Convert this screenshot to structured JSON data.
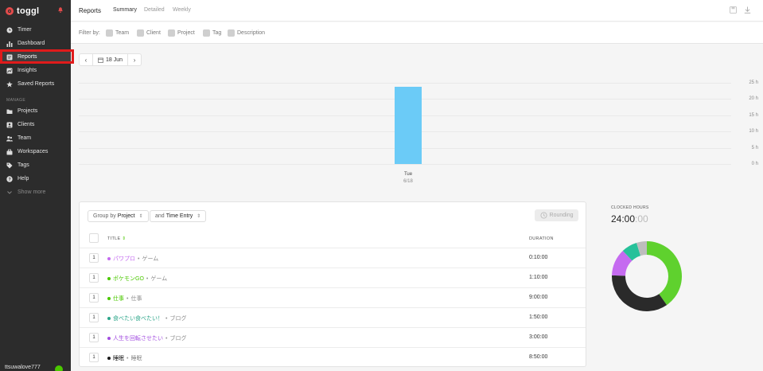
{
  "sidebar": {
    "brand": "toggl",
    "items": [
      {
        "label": "Timer",
        "icon": "clock-icon"
      },
      {
        "label": "Dashboard",
        "icon": "bar-chart-icon"
      },
      {
        "label": "Reports",
        "icon": "report-icon"
      },
      {
        "label": "Insights",
        "icon": "insights-icon"
      },
      {
        "label": "Saved Reports",
        "icon": "star-icon"
      }
    ],
    "manage_label": "MANAGE",
    "manage_items": [
      {
        "label": "Projects",
        "icon": "folder-icon"
      },
      {
        "label": "Clients",
        "icon": "clients-icon"
      },
      {
        "label": "Team",
        "icon": "team-icon"
      },
      {
        "label": "Workspaces",
        "icon": "workspaces-icon"
      },
      {
        "label": "Tags",
        "icon": "tag-icon"
      },
      {
        "label": "Help",
        "icon": "help-icon"
      },
      {
        "label": "Show more",
        "icon": "chevron-down-icon"
      }
    ],
    "user": "ttsuwalove777"
  },
  "header": {
    "title": "Reports",
    "tabs": [
      "Summary",
      "Detailed",
      "Weekly"
    ]
  },
  "filters": {
    "label": "Filter by:",
    "items": [
      "Team",
      "Client",
      "Project",
      "Tag",
      "Description"
    ]
  },
  "date_nav": {
    "date": "18 Jun",
    "prev": "‹",
    "next": "›"
  },
  "chart_data": {
    "type": "bar",
    "categories": [
      "Tue"
    ],
    "sublabels": [
      "6/18"
    ],
    "values": [
      23.8
    ],
    "yticks": [
      "25 h",
      "20 h",
      "15 h",
      "10 h",
      "5 h",
      "0 h"
    ],
    "ylim": [
      0,
      25
    ],
    "color": "#6bcbf7"
  },
  "table": {
    "group_by_prefix": "Group by",
    "group_by_value": "Project",
    "and_prefix": "and",
    "and_value": "Time Entry",
    "rounding": "Rounding",
    "col_title": "TITLE",
    "col_duration": "DURATION",
    "rows": [
      {
        "count": "1",
        "project": "パワプロ",
        "client": "ゲーム",
        "duration": "0:10:00",
        "color": "#c56bf0"
      },
      {
        "count": "1",
        "project": "ポケモンGO",
        "client": "ゲーム",
        "duration": "1:10:00",
        "color": "#4bc800"
      },
      {
        "count": "1",
        "project": "仕事",
        "client": "仕事",
        "duration": "9:00:00",
        "color": "#4bc800"
      },
      {
        "count": "1",
        "project": "食べたい食べたい！",
        "client": "ブログ",
        "duration": "1:50:00",
        "color": "#2da68a"
      },
      {
        "count": "1",
        "project": "人生を回転させたい",
        "client": "ブログ",
        "duration": "3:00:00",
        "color": "#a34ee0"
      },
      {
        "count": "1",
        "project": "睡眠",
        "client": "睡眠",
        "duration": "8:50:00",
        "color": "#1a1a1a"
      }
    ]
  },
  "clocked": {
    "label": "CLOCKED HOURS",
    "value_main": "24:00",
    "value_sec": ":00",
    "donut": [
      {
        "name": "仕事 / ポケモンGO",
        "value": 10.17,
        "color": "#5fd12e"
      },
      {
        "name": "睡眠",
        "value": 8.83,
        "color": "#2a2a2a"
      },
      {
        "name": "人生を回転させたい / パワプロ",
        "value": 3.17,
        "color": "#c56bf0"
      },
      {
        "name": "食べたい食べたい！",
        "value": 1.83,
        "color": "#27c19a"
      },
      {
        "name": "other",
        "value": 1.2,
        "color": "#bdbdbd"
      }
    ]
  }
}
